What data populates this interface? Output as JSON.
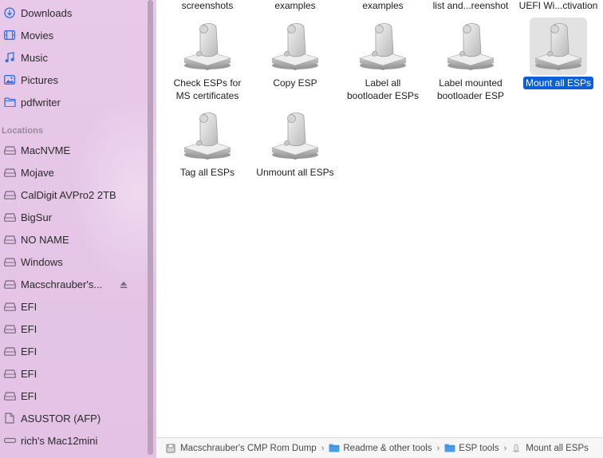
{
  "sidebar": {
    "favorites": [
      {
        "label": "Downloads",
        "icon": "download-circle-icon"
      },
      {
        "label": "Movies",
        "icon": "film-icon"
      },
      {
        "label": "Music",
        "icon": "music-note-icon"
      },
      {
        "label": "Pictures",
        "icon": "photo-icon"
      },
      {
        "label": "pdfwriter",
        "icon": "folder-icon"
      }
    ],
    "locations_heading": "Locations",
    "locations": [
      {
        "label": "MacNVME",
        "icon": "drive-icon"
      },
      {
        "label": "Mojave",
        "icon": "drive-icon"
      },
      {
        "label": "CalDigit AVPro2 2TB",
        "icon": "drive-icon"
      },
      {
        "label": "BigSur",
        "icon": "drive-icon"
      },
      {
        "label": "NO NAME",
        "icon": "drive-icon"
      },
      {
        "label": "Windows",
        "icon": "drive-icon"
      },
      {
        "label": "Macschrauber's...",
        "icon": "drive-icon"
      },
      {
        "label": "EFI",
        "icon": "drive-icon"
      },
      {
        "label": "EFI",
        "icon": "drive-icon"
      },
      {
        "label": "EFI",
        "icon": "drive-icon"
      },
      {
        "label": "EFI",
        "icon": "drive-icon"
      },
      {
        "label": "EFI",
        "icon": "drive-icon"
      },
      {
        "label": "ASUSTOR (AFP)",
        "icon": "document-icon"
      },
      {
        "label": "rich's Mac12mini",
        "icon": "display-icon"
      }
    ]
  },
  "main": {
    "top_labels": [
      "screenshots",
      "examples",
      "examples",
      "list and...reenshot",
      "UEFI Wi...ctivation"
    ],
    "items": [
      {
        "line1": "Check ESPs for",
        "line2": "MS certificates",
        "selected": false
      },
      {
        "line1": "Copy ESP",
        "line2": "",
        "selected": false
      },
      {
        "line1": "Label all",
        "line2": "bootloader ESPs",
        "selected": false
      },
      {
        "line1": "Label mounted",
        "line2": "bootloader ESP",
        "selected": false
      },
      {
        "line1": "Mount all ESPs",
        "line2": "",
        "selected": true
      },
      {
        "line1": "Tag all ESPs",
        "line2": "",
        "selected": false
      },
      {
        "line1": "Unmount all ESPs",
        "line2": "",
        "selected": false
      }
    ]
  },
  "pathbar": {
    "crumbs": [
      {
        "label": "Macschrauber's CMP Rom Dump",
        "icon": "disk-icon"
      },
      {
        "label": "Readme & other tools",
        "icon": "folder-icon"
      },
      {
        "label": "ESP tools",
        "icon": "folder-icon"
      },
      {
        "label": "Mount all ESPs",
        "icon": "script-icon"
      }
    ],
    "separator": "›"
  },
  "colors": {
    "sidebar_bg": "#e6c6e7",
    "selection": "#0b5fd9",
    "accent_icon": "#2f6fe0"
  }
}
